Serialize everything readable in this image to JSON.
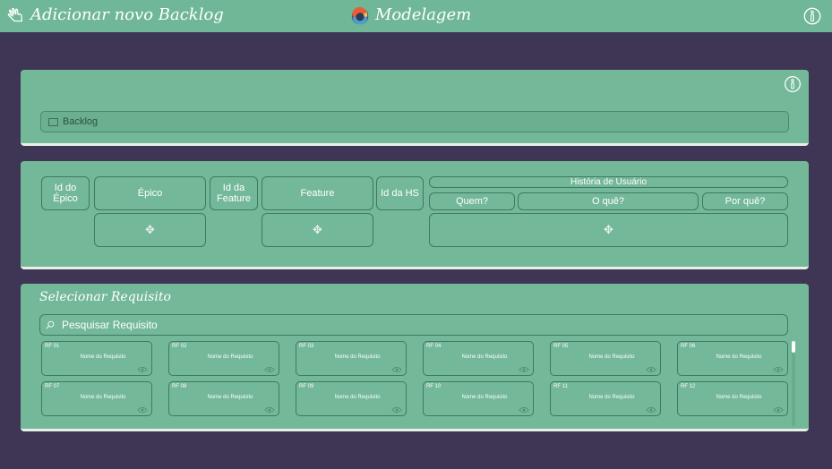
{
  "topbar": {
    "title": "Adicionar novo Backlog",
    "center_title": "Modelagem",
    "back_icon": "back-hand-icon",
    "info_icon": "info-icon",
    "logo_icon": "modelagem-logo-icon"
  },
  "backlog_section": {
    "field_label": "Backlog"
  },
  "table_section": {
    "id_epico": "Id do Épico",
    "epico": "Épico",
    "id_feature": "Id da Feature",
    "feature": "Feature",
    "id_hs": "Id da HS",
    "historia": "História de Usuário",
    "quem": "Quem?",
    "o_que": "O quê?",
    "por_que": "Por quê?",
    "add_symbol": "✥"
  },
  "requisitos_section": {
    "title": "Selecionar Requisito",
    "search_placeholder": "Pesquisar Requisito",
    "cards": [
      {
        "id": "RF 01",
        "name": "Nome do Requisito"
      },
      {
        "id": "RF 02",
        "name": "Nome do Requisito"
      },
      {
        "id": "RF 03",
        "name": "Nome do Requisito"
      },
      {
        "id": "RF 04",
        "name": "Nome do Requisito"
      },
      {
        "id": "RF 05",
        "name": "Nome do Requisito"
      },
      {
        "id": "RF 06",
        "name": "Nome do Requisito"
      },
      {
        "id": "RF 07",
        "name": "Nome do Requisito"
      },
      {
        "id": "RF 08",
        "name": "Nome do Requisito"
      },
      {
        "id": "RF 09",
        "name": "Nome do Requisito"
      },
      {
        "id": "RF 10",
        "name": "Nome do Requisito"
      },
      {
        "id": "RF 11",
        "name": "Nome do Requisito"
      },
      {
        "id": "RF 12",
        "name": "Nome do Requisito"
      }
    ]
  },
  "colors": {
    "background": "#3f3655",
    "topbar": "#6fb796",
    "panel": "#73b898"
  }
}
